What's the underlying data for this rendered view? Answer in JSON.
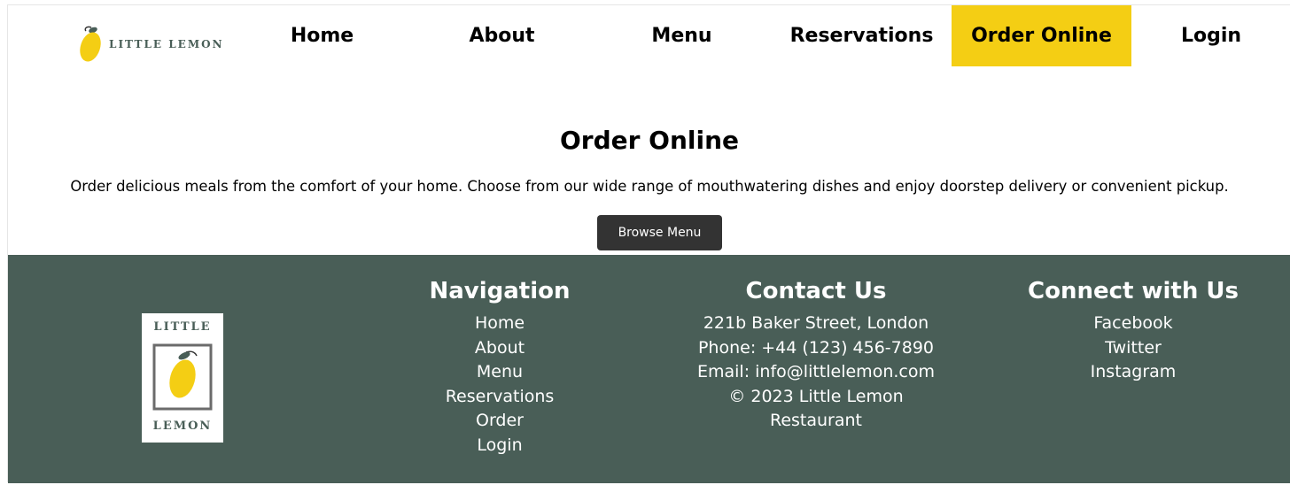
{
  "brand": {
    "name": "LITTLE LEMON",
    "footer_logo_top": "LITTLE",
    "footer_logo_bottom": "LEMON"
  },
  "nav": {
    "items": [
      {
        "label": "Home",
        "active": false
      },
      {
        "label": "About",
        "active": false
      },
      {
        "label": "Menu",
        "active": false
      },
      {
        "label": "Reservations",
        "active": false
      },
      {
        "label": "Order Online",
        "active": true
      },
      {
        "label": "Login",
        "active": false
      }
    ]
  },
  "hero": {
    "title": "Order Online",
    "description": "Order delicious meals from the comfort of your home. Choose from our wide range of mouthwatering dishes and enjoy doorstep delivery or convenient pickup.",
    "button_label": "Browse Menu"
  },
  "footer": {
    "navigation": {
      "heading": "Navigation",
      "links": [
        "Home",
        "About",
        "Menu",
        "Reservations",
        "Order",
        "Login"
      ]
    },
    "contact": {
      "heading": "Contact Us",
      "address": "221b Baker Street, London",
      "phone": "Phone: +44 (123) 456-7890",
      "email": "Email: info@littlelemon.com",
      "copyright": "© 2023 Little Lemon Restaurant"
    },
    "social": {
      "heading": "Connect with Us",
      "links": [
        "Facebook",
        "Twitter",
        "Instagram"
      ]
    }
  },
  "colors": {
    "accent": "#f4ce14",
    "footer_bg": "#495e57",
    "button_bg": "#333333"
  }
}
